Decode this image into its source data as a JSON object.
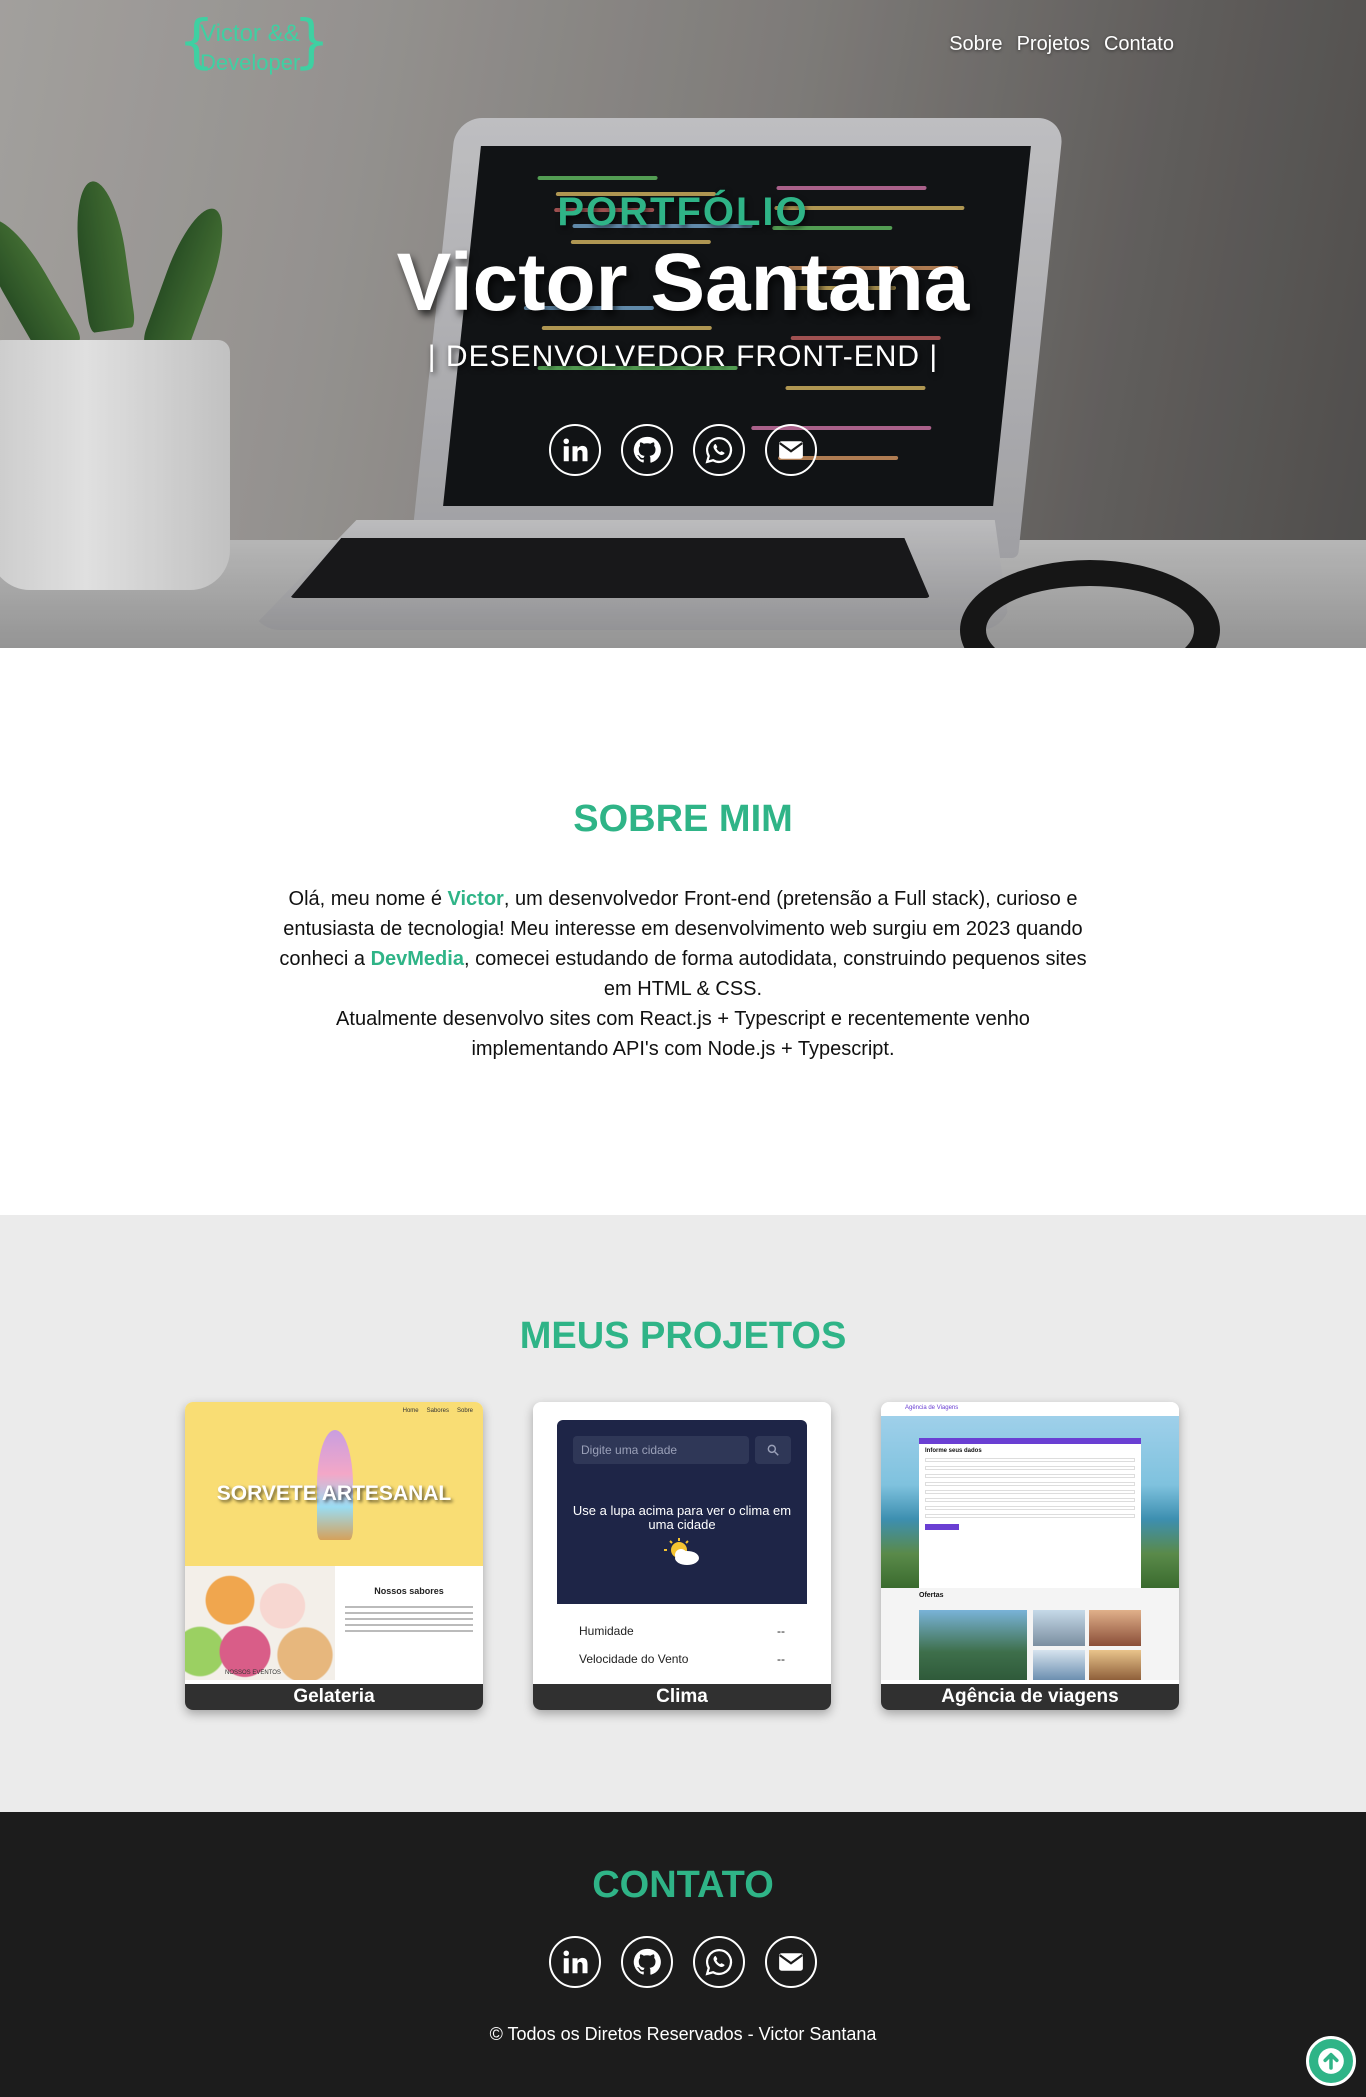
{
  "header": {
    "logo": {
      "line1": "Victor &&",
      "line2": "Developer",
      "brace_left": "{",
      "brace_right": "}"
    },
    "menu": [
      {
        "label": "Sobre"
      },
      {
        "label": "Projetos"
      },
      {
        "label": "Contato"
      }
    ]
  },
  "hero": {
    "kicker": "PORTFÓLIO",
    "name": "Victor Santana",
    "role": "| DESENVOLVEDOR FRONT-END |",
    "socials": [
      "linkedin-icon",
      "github-icon",
      "whatsapp-icon",
      "email-icon"
    ]
  },
  "sobre": {
    "title": "SOBRE MIM",
    "p1_a": "Olá, meu nome é ",
    "p1_name": "Victor",
    "p1_b": ", um desenvolvedor Front-end (pretensão a Full stack), curioso e entusiasta de tecnologia! Meu interesse em desenvolvimento web surgiu em 2023 quando conheci a ",
    "p1_devmedia": "DevMedia",
    "p1_c": ", comecei estudando de forma autodidata, construindo pequenos sites em HTML & CSS.",
    "p2": "Atualmente desenvolvo sites com React.js + Typescript e recentemente venho implementando API's com Node.js + Typescript."
  },
  "projetos": {
    "title": "MEUS PROJETOS",
    "cards": [
      {
        "caption": "Gelateria",
        "preview": {
          "hero_title": "SORVETE ARTESANAL",
          "nav": [
            "Home",
            "Sabores",
            "Sobre"
          ],
          "section_title": "Nossos sabores",
          "events": "NOSSOS EVENTOS"
        }
      },
      {
        "caption": "Clima",
        "preview": {
          "placeholder": "Digite uma cidade",
          "message": "Use a lupa acima para ver o clima em uma cidade",
          "rows": [
            {
              "label": "Humidade",
              "value": "--"
            },
            {
              "label": "Velocidade do Vento",
              "value": "--"
            }
          ]
        }
      },
      {
        "caption": "Agência de viagens",
        "preview": {
          "brand": "Agência de Viagens",
          "form_title": "Informe seus dados",
          "offers_title": "Ofertas"
        }
      }
    ]
  },
  "contato": {
    "title": "CONTATO",
    "socials": [
      "linkedin-icon",
      "github-icon",
      "whatsapp-icon",
      "email-icon"
    ],
    "copyright": "© Todos os Diretos Reservados - Victor Santana"
  },
  "colors": {
    "accent": "#2fb487",
    "logo": "#3fd0a2",
    "footer_bg": "#1c1c1c",
    "projects_bg": "#ebebeb"
  }
}
